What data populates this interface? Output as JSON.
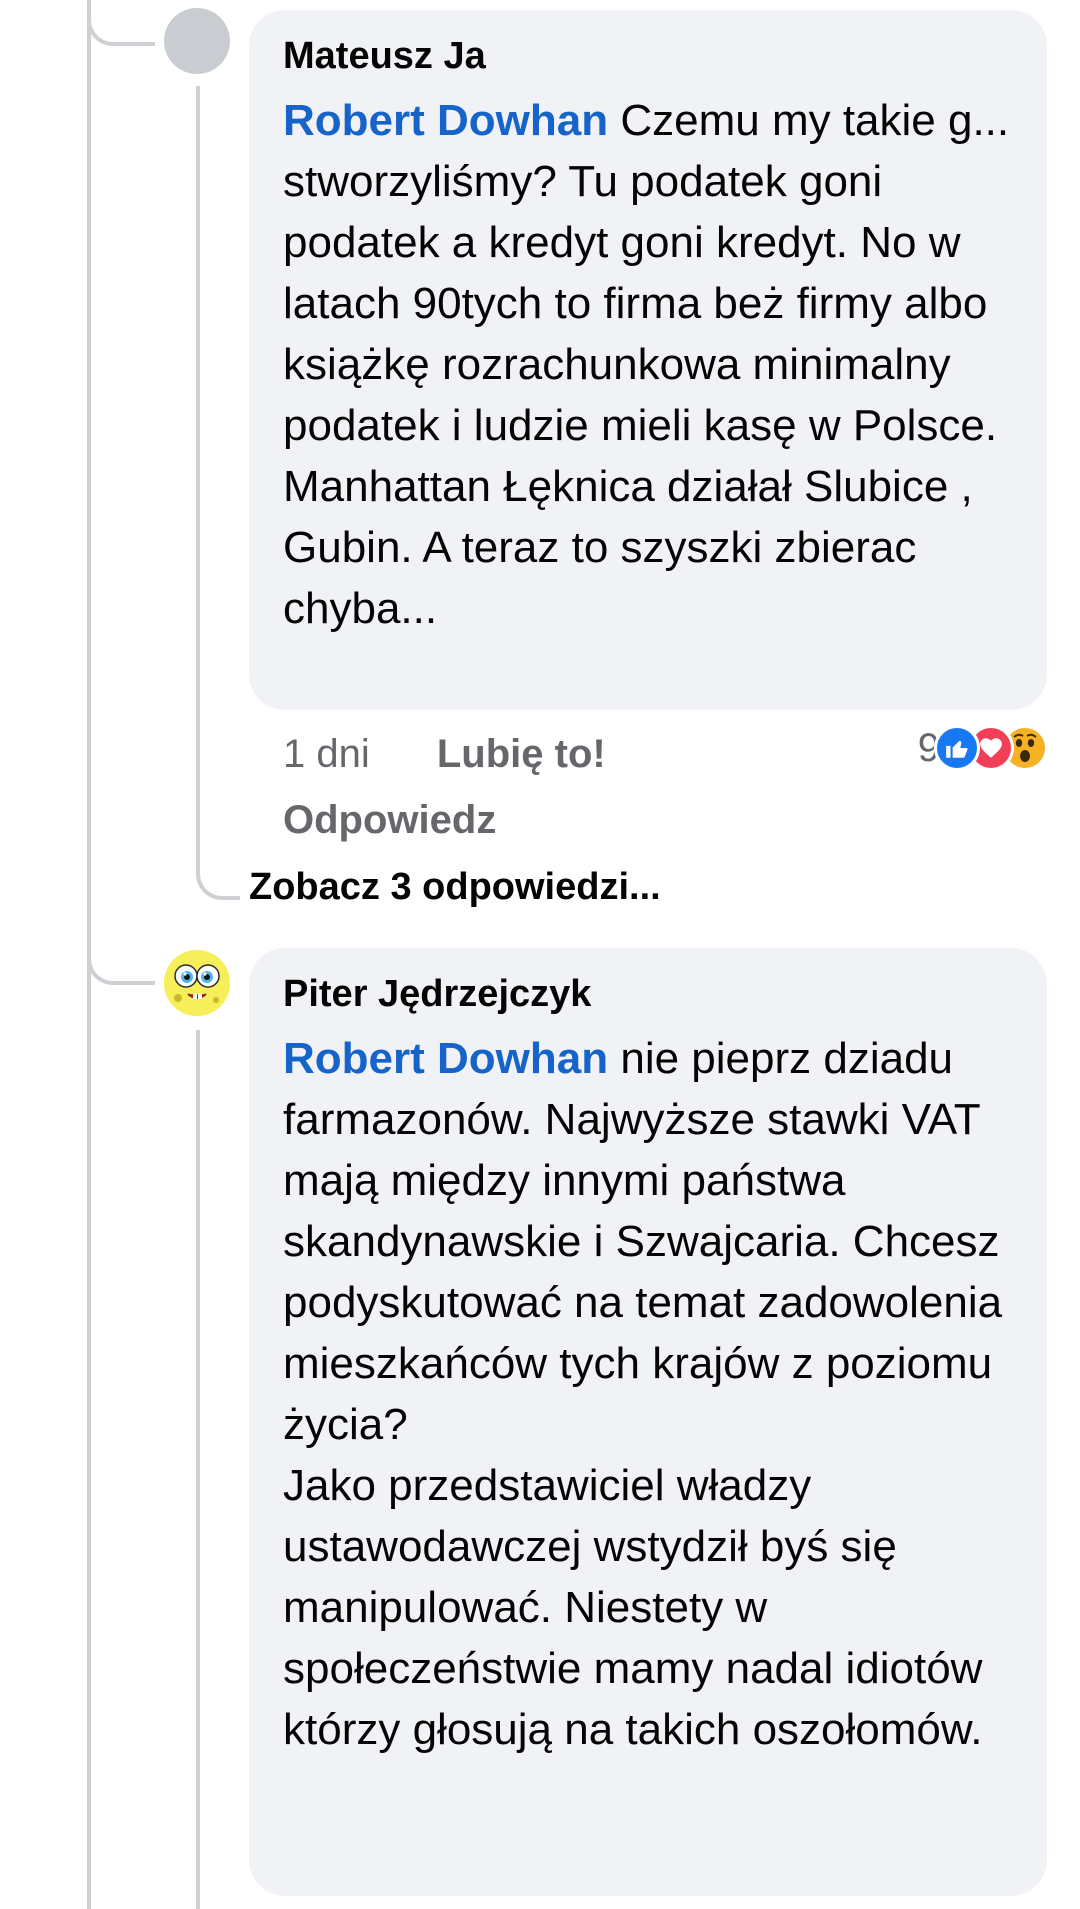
{
  "comments": [
    {
      "author": "Mateusz Ja",
      "mention": "Robert Dowhan",
      "text": "Czemu my takie g... stworzyliśmy? Tu podatek goni podatek a kredyt goni kredyt. No w latach 90tych to firma beż firmy albo książkę rozrachunkowa minimalny podatek i ludzie mieli kasę w Polsce. Manhattan Łęknica działał Slubice , Gubin. A teraz to szyszki zbierac chyba...",
      "time": "1 dni",
      "like_label": "Lubię to!",
      "reply_label": "Odpowiedz",
      "reaction_count": "9",
      "reactions": [
        "like-icon",
        "love-icon",
        "wow-icon"
      ],
      "avatar": "gray-placeholder-avatar"
    },
    {
      "author": "Piter Jędrzejczyk",
      "mention": "Robert Dowhan",
      "text": "nie pieprz dziadu farmazonów. Najwyższe stawki VAT mają między innymi państwa skandynawskie i Szwajcaria. Chcesz podyskutować na temat zadowolenia mieszkańców tych krajów z poziomu życia?",
      "text_2": "Jako przedstawiciel władzy ustawodawczej wstydził byś się manipulować. Niestety w społeczeństwie mamy nadal idiotów którzy głosują na takich oszołomów.",
      "avatar": "spongebob-avatar"
    }
  ],
  "see_replies_label": "Zobacz 3 odpowiedzi...",
  "colors": {
    "bubble_bg": "#f0f2f5",
    "mention": "#1664c9",
    "meta_text": "#65676b",
    "thread_line": "#ced0d4"
  }
}
